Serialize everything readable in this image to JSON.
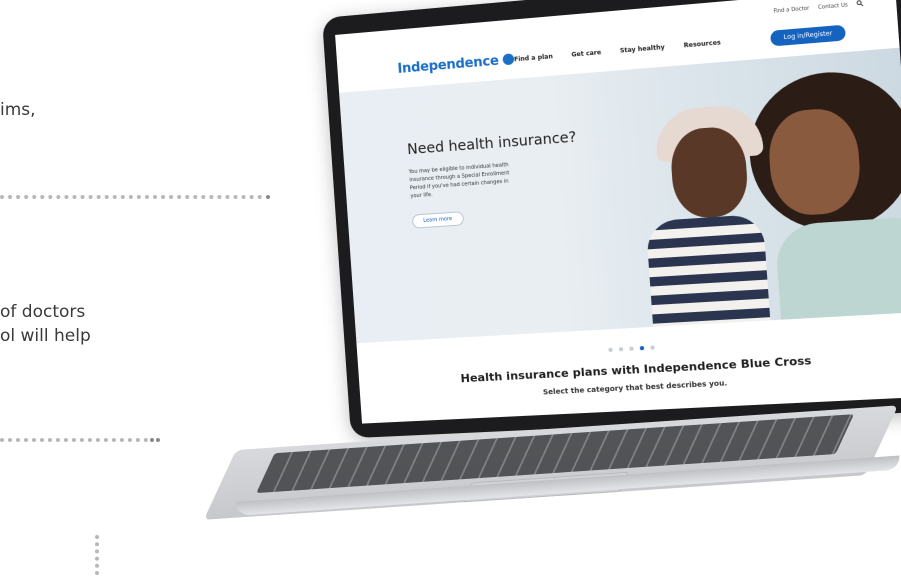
{
  "left_copy": {
    "line1": "ims,",
    "line2": "of doctors",
    "line3": "ol will help"
  },
  "laptop_site": {
    "utility_links": [
      "Find a Doctor",
      "Contact Us"
    ],
    "utility_icon": "search-icon",
    "logo_text": "Independence",
    "nav_links": [
      "Find a plan",
      "Get care",
      "Stay healthy",
      "Resources"
    ],
    "login_button": "Log in/Register",
    "hero": {
      "title": "Need health insurance?",
      "body": "You may be eligible to individual health insurance through a Special Enrollment Period if you've had certain changes in your life.",
      "cta": "Learn more"
    },
    "carousel": {
      "count": 5,
      "active_index": 3
    },
    "plans_title": "Health insurance plans with Independence Blue Cross",
    "plans_subtitle": "Select the category that best describes you."
  },
  "colors": {
    "brand_blue": "#1463c0",
    "logo_blue": "#1b6fc6",
    "dots": "#b8b8b8"
  }
}
